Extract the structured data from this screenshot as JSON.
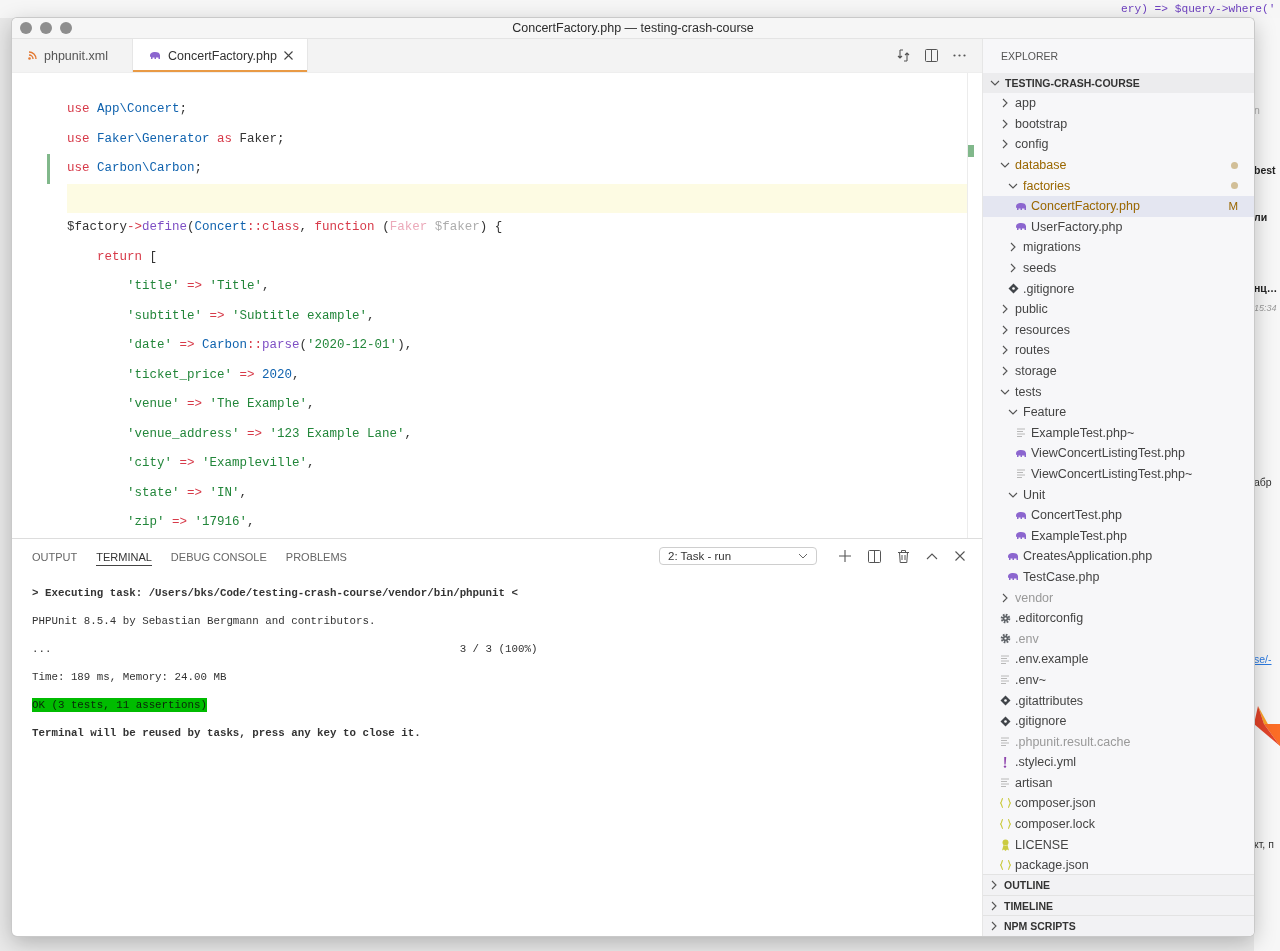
{
  "desktop": {
    "back_code": "ery) => $query->where('",
    "side_texts": [
      {
        "kind": "muted",
        "text": "n"
      },
      {
        "kind": "bold",
        "text": "best"
      },
      {
        "kind": "bold",
        "text": "ли"
      },
      {
        "kind": "bold",
        "text": "нц…"
      },
      {
        "kind": "time",
        "text": "15:34"
      },
      {
        "kind": "plain",
        "text": "абр"
      },
      {
        "kind": "link",
        "text": "se/-"
      },
      {
        "kind": "plain",
        "text": "кт, п"
      }
    ]
  },
  "window": {
    "title": "ConcertFactory.php — testing-crash-course"
  },
  "tabs": [
    {
      "label": "phpunit.xml",
      "kind": "xml",
      "selected": false
    },
    {
      "label": "ConcertFactory.php",
      "kind": "php",
      "selected": true
    }
  ],
  "editor": {
    "lines": [
      {
        "current": false,
        "changed": false,
        "tokens": [
          {
            "kind": "keyword",
            "text": "use"
          },
          {
            "kind": "class",
            "text": " App\\Concert"
          },
          {
            "kind": "plain",
            "text": ";"
          }
        ]
      },
      {
        "current": false,
        "changed": false,
        "tokens": [
          {
            "kind": "keyword",
            "text": "use"
          },
          {
            "kind": "class",
            "text": " Faker\\Generator"
          },
          {
            "kind": "keyword",
            "text": " as"
          },
          {
            "kind": "plain",
            "text": " Faker;"
          }
        ]
      },
      {
        "current": false,
        "changed": true,
        "tokens": [
          {
            "kind": "keyword",
            "text": "use"
          },
          {
            "kind": "class",
            "text": " Carbon\\Carbon"
          },
          {
            "kind": "plain",
            "text": ";"
          }
        ]
      },
      {
        "current": true,
        "changed": false
      },
      {
        "current": false,
        "changed": false,
        "tokens": [
          {
            "kind": "plain",
            "text": "$factory"
          },
          {
            "kind": "keyword",
            "text": "->"
          },
          {
            "kind": "function",
            "text": "define"
          },
          {
            "kind": "plain",
            "text": "("
          },
          {
            "kind": "class",
            "text": "Concert"
          },
          {
            "kind": "keyword",
            "text": "::class"
          },
          {
            "kind": "plain",
            "text": ", "
          },
          {
            "kind": "keyword",
            "text": "function"
          },
          {
            "kind": "plain",
            "text": " ("
          },
          {
            "kind": "type",
            "text": "Faker"
          },
          {
            "kind": "variable",
            "text": " $faker"
          },
          {
            "kind": "plain",
            "text": ") {"
          }
        ]
      },
      {
        "current": false,
        "changed": false,
        "tokens": [
          {
            "kind": "keyword",
            "text": "    return"
          },
          {
            "kind": "plain",
            "text": " ["
          }
        ]
      },
      {
        "current": false,
        "changed": false,
        "tokens": [
          {
            "kind": "string",
            "text": "        'title'"
          },
          {
            "kind": "keyword",
            "text": " =>"
          },
          {
            "kind": "string",
            "text": " 'Title'"
          },
          {
            "kind": "plain",
            "text": ","
          }
        ]
      },
      {
        "current": false,
        "changed": false,
        "tokens": [
          {
            "kind": "string",
            "text": "        'subtitle'"
          },
          {
            "kind": "keyword",
            "text": " =>"
          },
          {
            "kind": "string",
            "text": " 'Subtitle example'"
          },
          {
            "kind": "plain",
            "text": ","
          }
        ]
      },
      {
        "current": false,
        "changed": false,
        "tokens": [
          {
            "kind": "string",
            "text": "        'date'"
          },
          {
            "kind": "keyword",
            "text": " =>"
          },
          {
            "kind": "class",
            "text": " Carbon"
          },
          {
            "kind": "keyword",
            "text": "::"
          },
          {
            "kind": "function",
            "text": "parse"
          },
          {
            "kind": "plain",
            "text": "("
          },
          {
            "kind": "string",
            "text": "'2020-12-01'"
          },
          {
            "kind": "plain",
            "text": "),"
          }
        ]
      },
      {
        "current": false,
        "changed": false,
        "tokens": [
          {
            "kind": "string",
            "text": "        'ticket_price'"
          },
          {
            "kind": "keyword",
            "text": " =>"
          },
          {
            "kind": "number",
            "text": " 2020"
          },
          {
            "kind": "plain",
            "text": ","
          }
        ]
      },
      {
        "current": false,
        "changed": false,
        "tokens": [
          {
            "kind": "string",
            "text": "        'venue'"
          },
          {
            "kind": "keyword",
            "text": " =>"
          },
          {
            "kind": "string",
            "text": " 'The Example'"
          },
          {
            "kind": "plain",
            "text": ","
          }
        ]
      },
      {
        "current": false,
        "changed": false,
        "tokens": [
          {
            "kind": "string",
            "text": "        'venue_address'"
          },
          {
            "kind": "keyword",
            "text": " =>"
          },
          {
            "kind": "string",
            "text": " '123 Example Lane'"
          },
          {
            "kind": "plain",
            "text": ","
          }
        ]
      },
      {
        "current": false,
        "changed": false,
        "tokens": [
          {
            "kind": "string",
            "text": "        'city'"
          },
          {
            "kind": "keyword",
            "text": " =>"
          },
          {
            "kind": "string",
            "text": " 'Exampleville'"
          },
          {
            "kind": "plain",
            "text": ","
          }
        ]
      },
      {
        "current": false,
        "changed": false,
        "tokens": [
          {
            "kind": "string",
            "text": "        'state'"
          },
          {
            "kind": "keyword",
            "text": " =>"
          },
          {
            "kind": "string",
            "text": " 'IN'"
          },
          {
            "kind": "plain",
            "text": ","
          }
        ]
      },
      {
        "current": false,
        "changed": false,
        "tokens": [
          {
            "kind": "string",
            "text": "        'zip'"
          },
          {
            "kind": "keyword",
            "text": " =>"
          },
          {
            "kind": "string",
            "text": " '17916'"
          },
          {
            "kind": "plain",
            "text": ","
          }
        ]
      }
    ]
  },
  "panel": {
    "tabs": [
      {
        "label": "OUTPUT",
        "selected": false
      },
      {
        "label": "TERMINAL",
        "selected": true
      },
      {
        "label": "DEBUG CONSOLE",
        "selected": false
      },
      {
        "label": "PROBLEMS",
        "selected": false
      }
    ],
    "terminal_select": "2: Task - run",
    "terminal_lines": [
      {
        "kind": "command",
        "text": "> Executing task: /Users/bks/Code/testing-crash-course/vendor/bin/phpunit <"
      },
      {
        "kind": "output",
        "text": "PHPUnit 8.5.4 by Sebastian Bergmann and contributors."
      },
      {
        "kind": "output",
        "text": "...",
        "right_text": "3 / 3 (100%)"
      },
      {
        "kind": "output",
        "text": "Time: 189 ms, Memory: 24.00 MB"
      },
      {
        "kind": "success",
        "text": "OK (3 tests, 11 assertions)"
      },
      {
        "kind": "notice",
        "text": "Terminal will be reused by tasks, press any key to close it."
      }
    ]
  },
  "explorer": {
    "title": "EXPLORER",
    "root": {
      "label": "TESTING-CRASH-COURSE",
      "expanded": true
    },
    "tree": [
      {
        "name": "app",
        "kind": "folder",
        "expanded": false,
        "selected": false,
        "modified": false,
        "dimmed": false
      },
      {
        "name": "bootstrap",
        "kind": "folder",
        "expanded": false,
        "selected": false,
        "modified": false,
        "dimmed": false
      },
      {
        "name": "config",
        "kind": "folder",
        "expanded": false,
        "selected": false,
        "modified": false,
        "dimmed": false
      },
      {
        "name": "database",
        "kind": "folder",
        "expanded": true,
        "selected": false,
        "modified": true,
        "dimmed": false,
        "children": [
          {
            "name": "factories",
            "kind": "folder",
            "expanded": true,
            "selected": false,
            "modified": true,
            "dimmed": false,
            "children": [
              {
                "name": "ConcertFactory.php",
                "kind": "php",
                "selected": true,
                "modified": true,
                "dimmed": false,
                "badge": "M"
              },
              {
                "name": "UserFactory.php",
                "kind": "php",
                "selected": false,
                "modified": false,
                "dimmed": false
              }
            ]
          },
          {
            "name": "migrations",
            "kind": "folder",
            "expanded": false,
            "selected": false,
            "modified": false,
            "dimmed": false
          },
          {
            "name": "seeds",
            "kind": "folder",
            "expanded": false,
            "selected": false,
            "modified": false,
            "dimmed": false
          },
          {
            "name": ".gitignore",
            "kind": "git",
            "selected": false,
            "modified": false,
            "dimmed": false
          }
        ]
      },
      {
        "name": "public",
        "kind": "folder",
        "expanded": false,
        "selected": false,
        "modified": false,
        "dimmed": false
      },
      {
        "name": "resources",
        "kind": "folder",
        "expanded": false,
        "selected": false,
        "modified": false,
        "dimmed": false
      },
      {
        "name": "routes",
        "kind": "folder",
        "expanded": false,
        "selected": false,
        "modified": false,
        "dimmed": false
      },
      {
        "name": "storage",
        "kind": "folder",
        "expanded": false,
        "selected": false,
        "modified": false,
        "dimmed": false
      },
      {
        "name": "tests",
        "kind": "folder",
        "expanded": true,
        "selected": false,
        "modified": false,
        "dimmed": false,
        "children": [
          {
            "name": "Feature",
            "kind": "folder",
            "expanded": true,
            "selected": false,
            "modified": false,
            "dimmed": false,
            "children": [
              {
                "name": "ExampleTest.php~",
                "kind": "text",
                "selected": false,
                "modified": false,
                "dimmed": false
              },
              {
                "name": "ViewConcertListingTest.php",
                "kind": "php",
                "selected": false,
                "modified": false,
                "dimmed": false
              },
              {
                "name": "ViewConcertListingTest.php~",
                "kind": "text",
                "selected": false,
                "modified": false,
                "dimmed": false
              }
            ]
          },
          {
            "name": "Unit",
            "kind": "folder",
            "expanded": true,
            "selected": false,
            "modified": false,
            "dimmed": false,
            "children": [
              {
                "name": "ConcertTest.php",
                "kind": "php",
                "selected": false,
                "modified": false,
                "dimmed": false
              },
              {
                "name": "ExampleTest.php",
                "kind": "php",
                "selected": false,
                "modified": false,
                "dimmed": false
              }
            ]
          },
          {
            "name": "CreatesApplication.php",
            "kind": "php",
            "selected": false,
            "modified": false,
            "dimmed": false
          },
          {
            "name": "TestCase.php",
            "kind": "php",
            "selected": false,
            "modified": false,
            "dimmed": false
          }
        ]
      },
      {
        "name": "vendor",
        "kind": "folder",
        "expanded": false,
        "selected": false,
        "modified": false,
        "dimmed": true
      },
      {
        "name": ".editorconfig",
        "kind": "gear",
        "selected": false,
        "modified": false,
        "dimmed": false
      },
      {
        "name": ".env",
        "kind": "gear",
        "selected": false,
        "modified": false,
        "dimmed": true
      },
      {
        "name": ".env.example",
        "kind": "text",
        "selected": false,
        "modified": false,
        "dimmed": false
      },
      {
        "name": ".env~",
        "kind": "text",
        "selected": false,
        "modified": false,
        "dimmed": false
      },
      {
        "name": ".gitattributes",
        "kind": "git",
        "selected": false,
        "modified": false,
        "dimmed": false
      },
      {
        "name": ".gitignore",
        "kind": "git",
        "selected": false,
        "modified": false,
        "dimmed": false
      },
      {
        "name": ".phpunit.result.cache",
        "kind": "text",
        "selected": false,
        "modified": false,
        "dimmed": true
      },
      {
        "name": ".styleci.yml",
        "kind": "yaml",
        "selected": false,
        "modified": false,
        "dimmed": false
      },
      {
        "name": "artisan",
        "kind": "text",
        "selected": false,
        "modified": false,
        "dimmed": false
      },
      {
        "name": "composer.json",
        "kind": "json",
        "selected": false,
        "modified": false,
        "dimmed": false
      },
      {
        "name": "composer.lock",
        "kind": "json",
        "selected": false,
        "modified": false,
        "dimmed": false
      },
      {
        "name": "LICENSE",
        "kind": "license",
        "selected": false,
        "modified": false,
        "dimmed": false
      },
      {
        "name": "package.json",
        "kind": "json",
        "selected": false,
        "modified": false,
        "dimmed": false
      }
    ],
    "sections": [
      {
        "label": "OUTLINE",
        "expanded": false
      },
      {
        "label": "TIMELINE",
        "expanded": false
      },
      {
        "label": "NPM SCRIPTS",
        "expanded": false
      }
    ]
  }
}
